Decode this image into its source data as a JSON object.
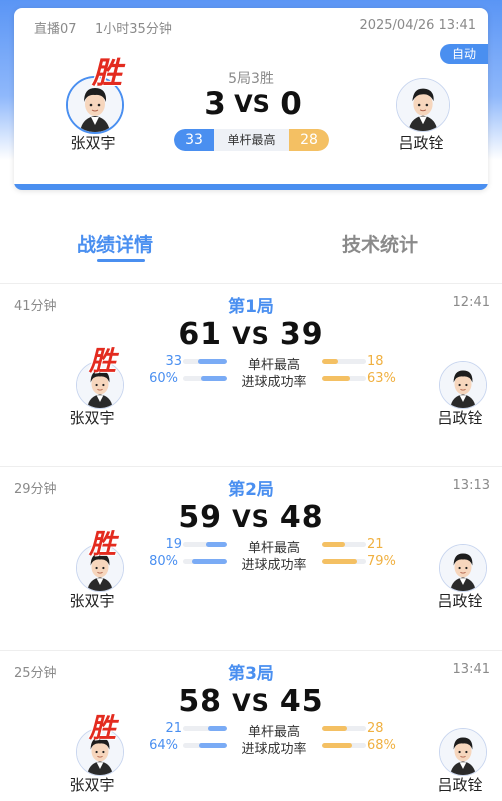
{
  "colors": {
    "blue": "#4a8ff0",
    "gold": "#f4c063",
    "win_red": "#e32b1f"
  },
  "header": {
    "stream": "直播07",
    "duration": "1小时35分钟",
    "datetime": "2025/04/26 13:41",
    "auto_badge": "自动",
    "format": "5局3胜",
    "score_left": "3",
    "vs": "VS",
    "score_right": "0",
    "player_left": "张双宇",
    "player_right": "吕政铨",
    "win_mark": "胜",
    "high_break_label": "单杆最高",
    "high_break_left": "33",
    "high_break_right": "28"
  },
  "tabs": [
    {
      "label": "战绩详情",
      "active": true
    },
    {
      "label": "技术统计",
      "active": false
    }
  ],
  "games": [
    {
      "duration": "41分钟",
      "title": "第1局",
      "time": "12:41",
      "score_left": "61",
      "score_right": "39",
      "player_left": "张双宇",
      "player_right": "吕政铨",
      "win_mark": "胜",
      "stats": [
        {
          "label": "单杆最高",
          "left": "33",
          "right": "18",
          "left_frac": 0.65,
          "right_frac": 0.36
        },
        {
          "label": "进球成功率",
          "left": "60%",
          "right": "63%",
          "left_frac": 0.6,
          "right_frac": 0.63
        }
      ]
    },
    {
      "duration": "29分钟",
      "title": "第2局",
      "time": "13:13",
      "score_left": "59",
      "score_right": "48",
      "player_left": "张双宇",
      "player_right": "吕政铨",
      "win_mark": "胜",
      "stats": [
        {
          "label": "单杆最高",
          "left": "19",
          "right": "21",
          "left_frac": 0.48,
          "right_frac": 0.53
        },
        {
          "label": "进球成功率",
          "left": "80%",
          "right": "79%",
          "left_frac": 0.8,
          "right_frac": 0.79
        }
      ]
    },
    {
      "duration": "25分钟",
      "title": "第3局",
      "time": "13:41",
      "score_left": "58",
      "score_right": "45",
      "player_left": "张双宇",
      "player_right": "吕政铨",
      "win_mark": "胜",
      "stats": [
        {
          "label": "单杆最高",
          "left": "21",
          "right": "28",
          "left_frac": 0.43,
          "right_frac": 0.57
        },
        {
          "label": "进球成功率",
          "left": "64%",
          "right": "68%",
          "left_frac": 0.64,
          "right_frac": 0.68
        }
      ]
    }
  ]
}
